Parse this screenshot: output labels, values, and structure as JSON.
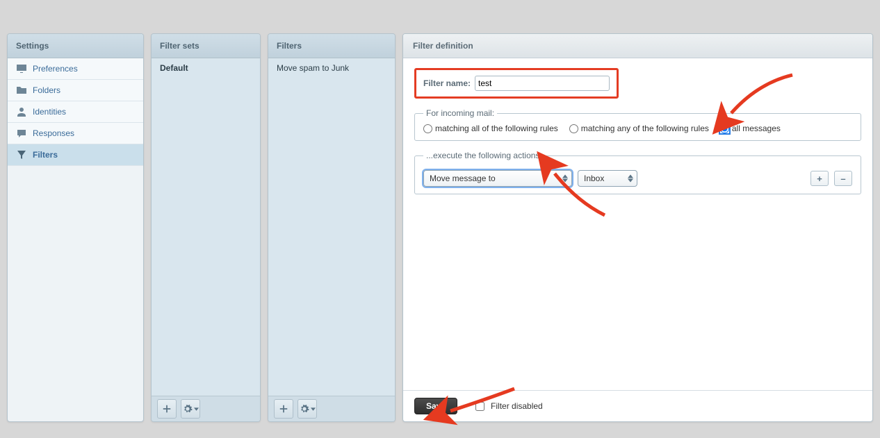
{
  "settings": {
    "title": "Settings",
    "items": [
      {
        "label": "Preferences",
        "icon": "monitor",
        "active": false
      },
      {
        "label": "Folders",
        "icon": "folder",
        "active": false
      },
      {
        "label": "Identities",
        "icon": "user",
        "active": false
      },
      {
        "label": "Responses",
        "icon": "reply",
        "active": false
      },
      {
        "label": "Filters",
        "icon": "filter",
        "active": true
      }
    ]
  },
  "filtersets": {
    "title": "Filter sets",
    "items": [
      {
        "label": "Default",
        "selected": true
      }
    ]
  },
  "filters": {
    "title": "Filters",
    "items": [
      {
        "label": "Move spam to Junk",
        "selected": false
      }
    ]
  },
  "definition": {
    "title": "Filter definition",
    "name_label": "Filter name:",
    "name_value": "test",
    "scope_legend": "For incoming mail:",
    "scope_options": [
      {
        "label": "matching all of the following rules",
        "value": "all_rules",
        "checked": false
      },
      {
        "label": "matching any of the following rules",
        "value": "any_rules",
        "checked": false
      },
      {
        "label": "all messages",
        "value": "all_msgs",
        "checked": true
      }
    ],
    "action_legend": "...execute the following actions:",
    "action_select": "Move message to",
    "target_select": "Inbox",
    "add_label": "+",
    "remove_label": "–",
    "save_label": "Save",
    "disabled_label": "Filter disabled",
    "disabled_checked": false
  }
}
